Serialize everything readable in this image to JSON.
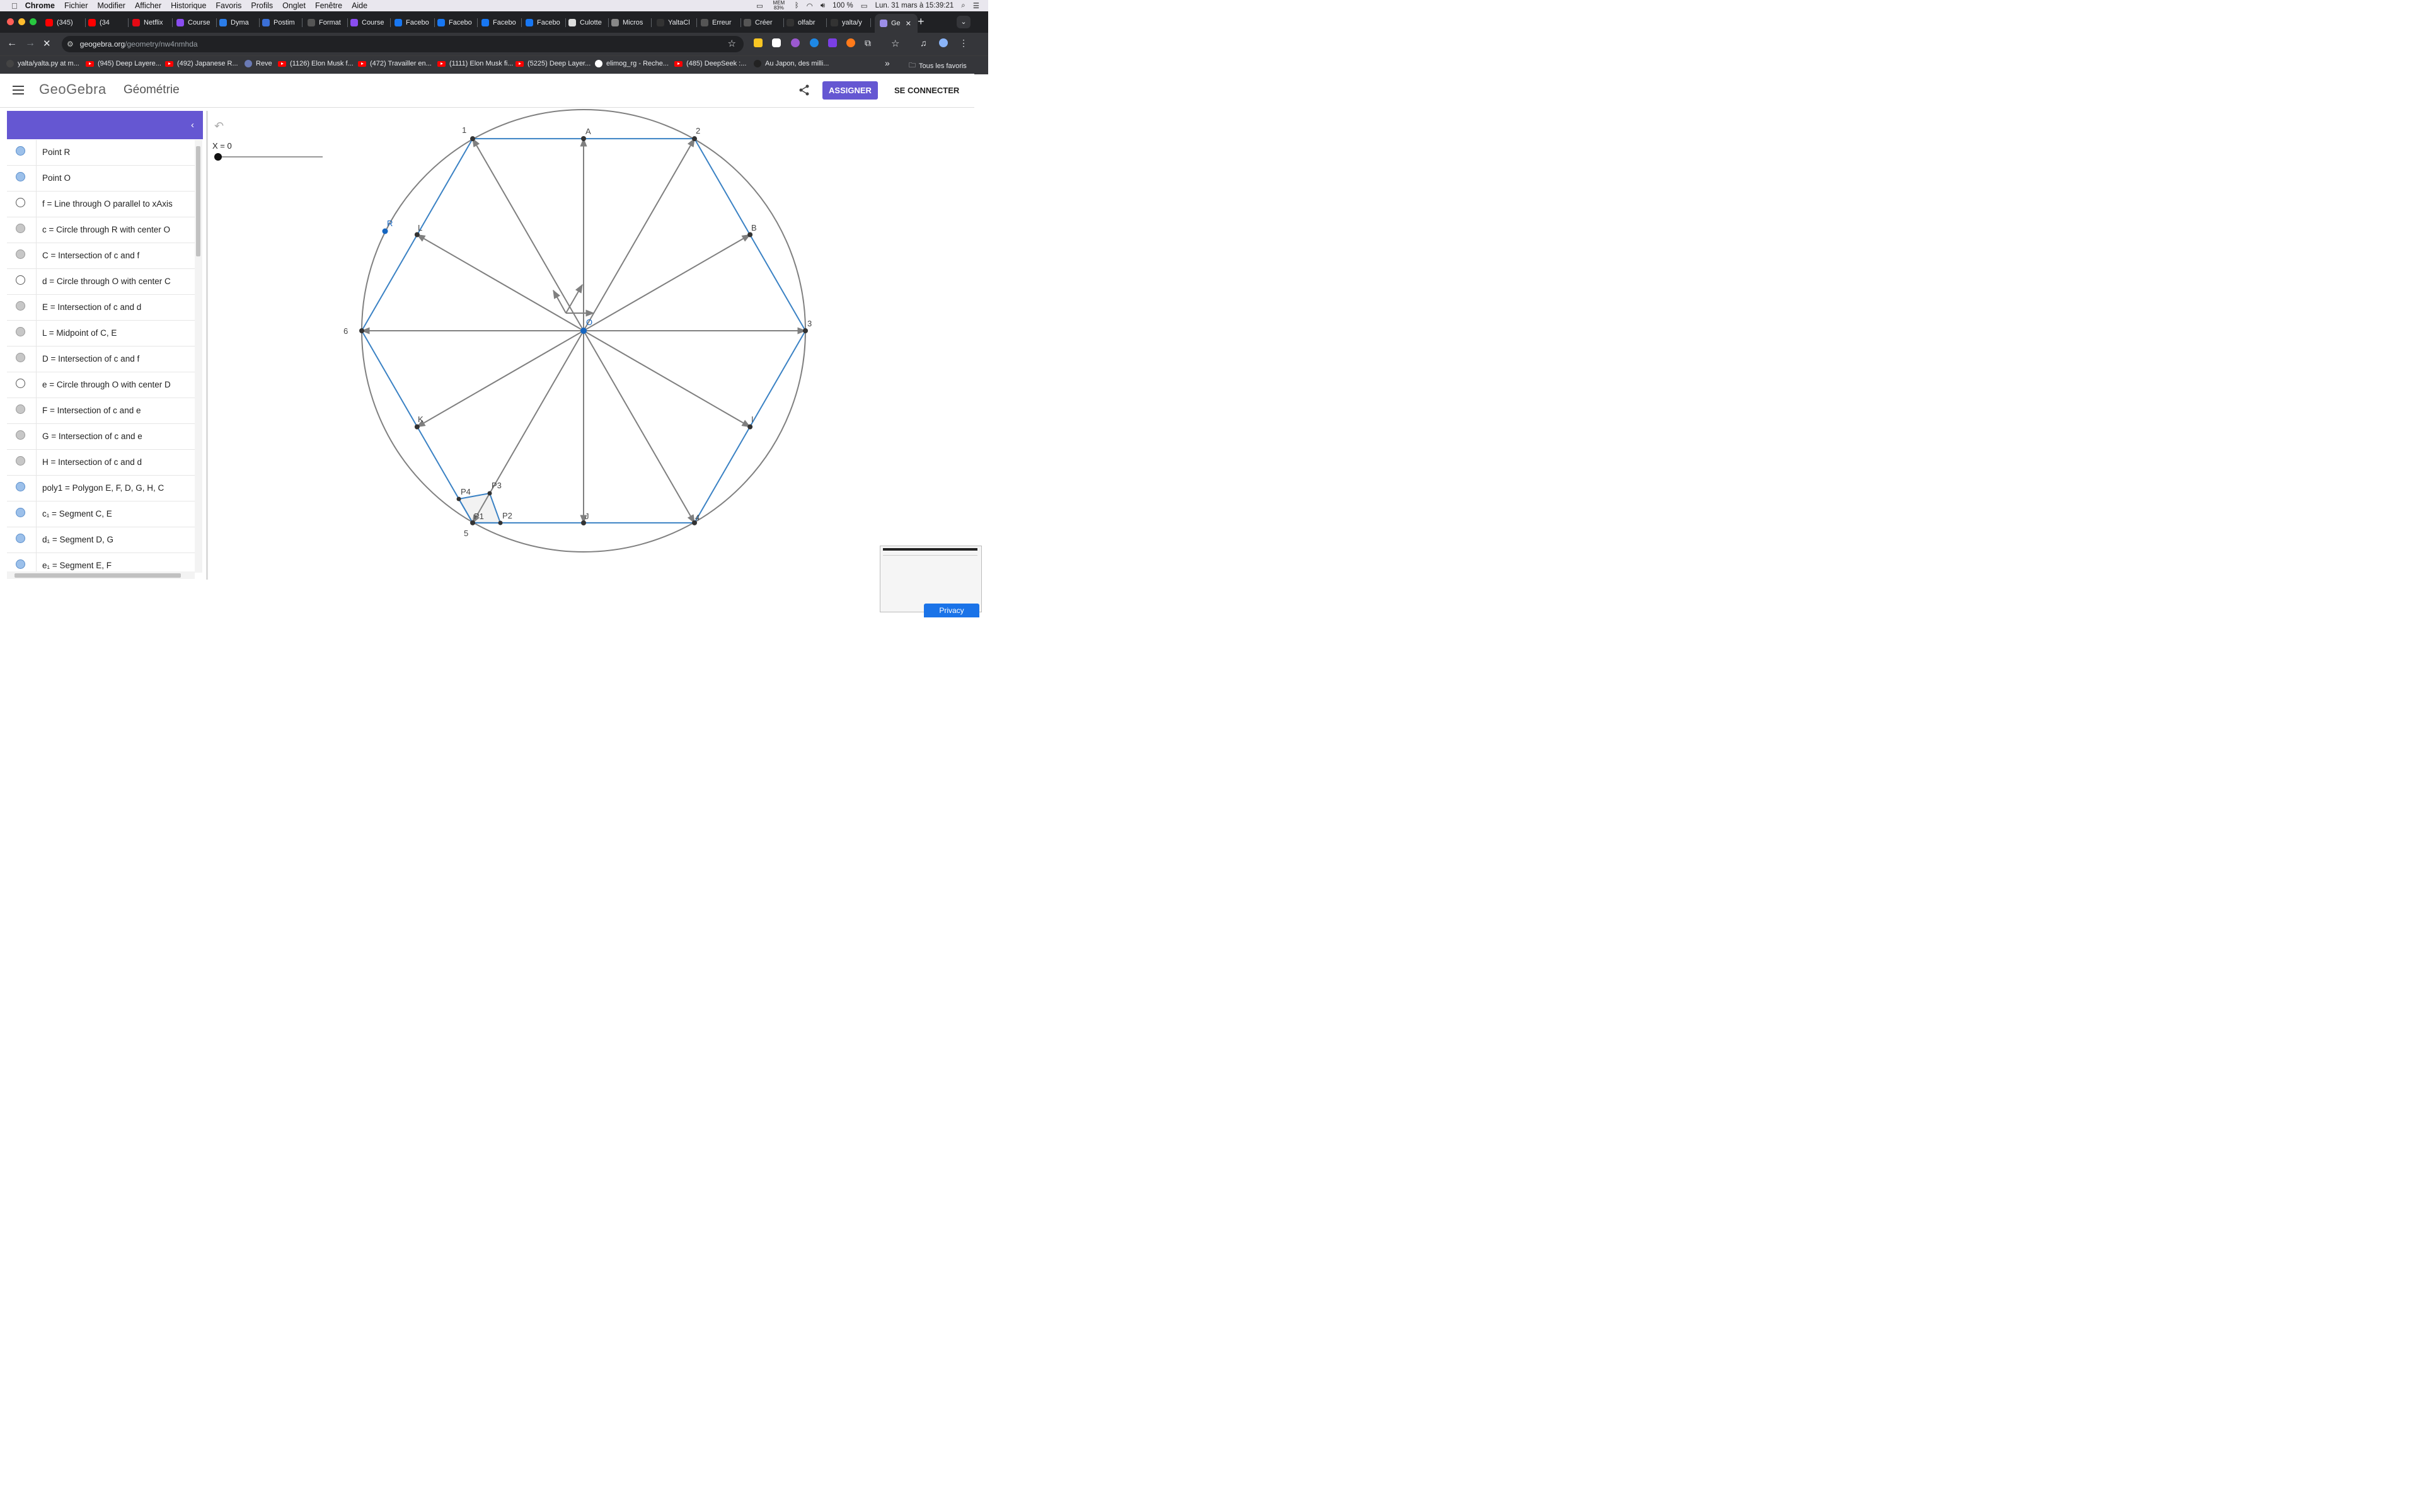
{
  "menubar": {
    "apple": "",
    "items": [
      "Chrome",
      "Fichier",
      "Modifier",
      "Afficher",
      "Historique",
      "Favoris",
      "Profils",
      "Onglet",
      "Fenêtre",
      "Aide"
    ],
    "memory": "MEM 83%",
    "battery": "100 %",
    "datetime": "Lun. 31 mars à  15:39:21"
  },
  "tabs": [
    {
      "label": "(345)",
      "icon": "youtube",
      "color": "#ff0000"
    },
    {
      "label": "(34",
      "icon": "youtube",
      "color": "#ff0000"
    },
    {
      "label": "Netflix",
      "icon": "netflix",
      "color": "#e50914"
    },
    {
      "label": "Course",
      "icon": "course",
      "color": "#8a4df0"
    },
    {
      "label": "Dyma",
      "icon": "dyma",
      "color": "#2b7de9"
    },
    {
      "label": "Postim",
      "icon": "postimages",
      "color": "#3b6fd6"
    },
    {
      "label": "Format",
      "icon": "openai",
      "color": "#555555"
    },
    {
      "label": "Course",
      "icon": "course",
      "color": "#8a4df0"
    },
    {
      "label": "Facebo",
      "icon": "facebook",
      "color": "#1877f2"
    },
    {
      "label": "Facebo",
      "icon": "facebook",
      "color": "#1877f2"
    },
    {
      "label": "Facebo",
      "icon": "facebook",
      "color": "#1877f2"
    },
    {
      "label": "Facebo",
      "icon": "facebook",
      "color": "#1877f2"
    },
    {
      "label": "Culotte",
      "icon": "medium",
      "color": "#dddddd"
    },
    {
      "label": "Micros",
      "icon": "globe",
      "color": "#888888"
    },
    {
      "label": "YaltaCl",
      "icon": "github",
      "color": "#333333"
    },
    {
      "label": "Erreur",
      "icon": "openai",
      "color": "#555555"
    },
    {
      "label": "Créer",
      "icon": "openai",
      "color": "#555555"
    },
    {
      "label": "olfabr",
      "icon": "github",
      "color": "#333333"
    },
    {
      "label": "yalta/y",
      "icon": "github",
      "color": "#333333"
    },
    {
      "label": "Ge",
      "icon": "geogebra",
      "color": "#9c8ee8"
    }
  ],
  "address": {
    "host": "geogebra.org",
    "path": "/geometry/nw4nmhda"
  },
  "bookmarks": [
    {
      "label": "yalta/yalta.py at m...",
      "icon": "github"
    },
    {
      "label": "(945) Deep Layere...",
      "icon": "youtube"
    },
    {
      "label": "(492) Japanese R...",
      "icon": "youtube"
    },
    {
      "label": "Reve",
      "icon": "reve"
    },
    {
      "label": "(1126) Elon Musk f...",
      "icon": "youtube"
    },
    {
      "label": "(472) Travailler en...",
      "icon": "youtube"
    },
    {
      "label": "(1111) Elon Musk fi...",
      "icon": "youtube"
    },
    {
      "label": "(5225) Deep Layer...",
      "icon": "youtube"
    },
    {
      "label": "elimog_rg - Reche...",
      "icon": "google"
    },
    {
      "label": "(485) DeepSeek :...",
      "icon": "youtube"
    },
    {
      "label": "Au Japon, des milli...",
      "icon": "aj"
    }
  ],
  "bookmarks_more": "»",
  "all_bookmarks": "Tous les favoris",
  "app": {
    "logo": "GeoGebra",
    "title": "Géométrie",
    "assign": "ASSIGNER",
    "login": "SE CONNECTER"
  },
  "algebra": [
    {
      "text": "Point R",
      "dot": "blue"
    },
    {
      "text": "Point O",
      "dot": "blue"
    },
    {
      "text": "f = Line through O parallel to xAxis",
      "dot": "empty"
    },
    {
      "text": "c = Circle through R with center O",
      "dot": "gray"
    },
    {
      "text": "C = Intersection of c and f",
      "dot": "gray"
    },
    {
      "text": "d = Circle through O with center C",
      "dot": "empty"
    },
    {
      "text": "E = Intersection of c and d",
      "dot": "gray"
    },
    {
      "text": "L = Midpoint of C, E",
      "dot": "gray"
    },
    {
      "text": "D = Intersection of c and f",
      "dot": "gray"
    },
    {
      "text": "e = Circle through O with center D",
      "dot": "empty"
    },
    {
      "text": "F = Intersection of c and e",
      "dot": "gray"
    },
    {
      "text": "G = Intersection of c and e",
      "dot": "gray"
    },
    {
      "text": "H = Intersection of c and d",
      "dot": "gray"
    },
    {
      "text": "poly1 = Polygon E, F, D, G, H, C",
      "dot": "blue"
    },
    {
      "text": "c₁ = Segment C, E",
      "dot": "blue"
    },
    {
      "text": "d₁ = Segment D, G",
      "dot": "blue"
    },
    {
      "text": "e₁ = Segment E, F",
      "dot": "blue"
    }
  ],
  "slider": {
    "label": "X = 0",
    "value": 0
  },
  "points": {
    "labels_numbers": [
      "1",
      "2",
      "3",
      "4",
      "5",
      "6"
    ],
    "labels_letters": [
      "A",
      "B",
      "I",
      "J",
      "K",
      "L",
      "R",
      "O"
    ],
    "labels_quad": [
      "P1",
      "P2",
      "P3",
      "P4"
    ]
  },
  "colors": {
    "accent": "#6557d2",
    "hexagon": "#3b82c4",
    "vector": "#7f7f7f",
    "circle": "#808080",
    "point_dark": "#333333",
    "point_blue": "#1565c0"
  },
  "privacy": "Privacy"
}
